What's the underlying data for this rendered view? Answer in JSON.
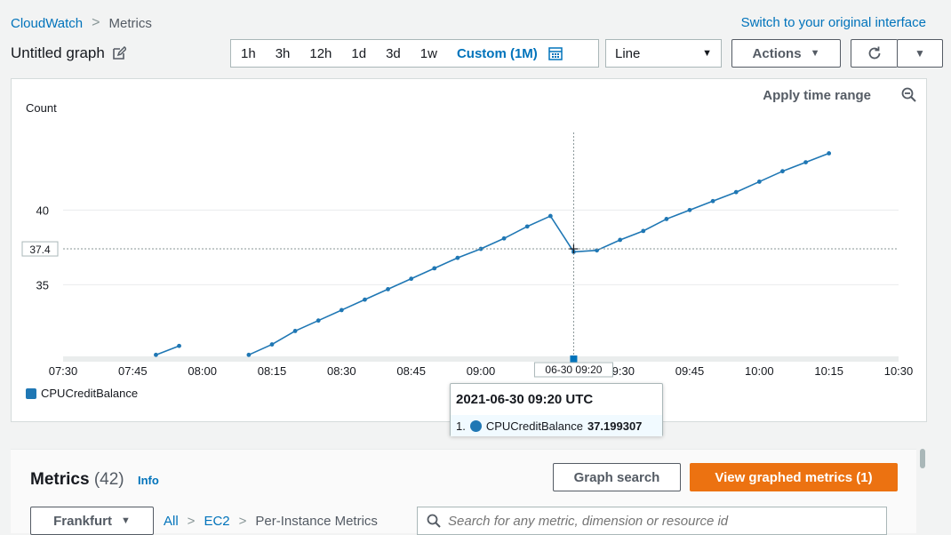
{
  "breadcrumb": {
    "root": "CloudWatch",
    "current": "Metrics"
  },
  "switch_link": "Switch to your original interface",
  "graph_title": "Untitled graph",
  "time_ranges": [
    "1h",
    "3h",
    "12h",
    "1d",
    "3d",
    "1w"
  ],
  "custom_range": "Custom (1M)",
  "view_select": "Line",
  "actions_label": "Actions",
  "apply_time_range": "Apply time range",
  "chart_data": {
    "type": "line",
    "ylabel": "Count",
    "y_ticks": [
      35,
      40
    ],
    "ylim": [
      30.2,
      45.2
    ],
    "x_ticks": [
      "07:30",
      "07:45",
      "08:00",
      "08:15",
      "08:30",
      "08:45",
      "09:00",
      "09:15",
      "09:30",
      "09:45",
      "10:00",
      "10:15",
      "10:30"
    ],
    "xlim_minutes": [
      450,
      630
    ],
    "crosshair_y_label": "37.4",
    "crosshair_x_label": "06-30 09:20",
    "grid": true,
    "series": [
      {
        "name": "CPUCreditBalance",
        "color": "#1f77b4",
        "segments": [
          {
            "x": [
              "07:50",
              "07:55"
            ],
            "y": [
              30.3,
              30.9
            ]
          },
          {
            "x": [
              "08:10",
              "08:15",
              "08:20",
              "08:25",
              "08:30",
              "08:35",
              "08:40",
              "08:45",
              "08:50",
              "08:55",
              "09:00",
              "09:05",
              "09:10",
              "09:15",
              "09:20",
              "09:25",
              "09:30",
              "09:35",
              "09:40",
              "09:45",
              "09:50",
              "09:55",
              "10:00",
              "10:05",
              "10:10",
              "10:15"
            ],
            "y": [
              30.3,
              31.0,
              31.9,
              32.6,
              33.3,
              34.0,
              34.7,
              35.4,
              36.1,
              36.8,
              37.4,
              38.1,
              38.9,
              39.6,
              37.2,
              37.3,
              38.0,
              38.6,
              39.4,
              40.0,
              40.6,
              41.2,
              41.9,
              42.6,
              43.2,
              43.8
            ]
          }
        ]
      }
    ]
  },
  "legend": {
    "label": "CPUCreditBalance",
    "color": "#1f77b4"
  },
  "tooltip": {
    "title": "2021-06-30 09:20 UTC",
    "index": "1.",
    "metric": "CPUCreditBalance",
    "value": "37.199307"
  },
  "metrics_panel": {
    "title": "Metrics",
    "count": "(42)",
    "info": "Info",
    "graph_search": "Graph search",
    "view_graphed": "View graphed metrics (1)",
    "region": "Frankfurt",
    "crumbs": [
      "All",
      "EC2",
      "Per-Instance Metrics"
    ],
    "search_placeholder": "Search for any metric, dimension or resource id"
  }
}
